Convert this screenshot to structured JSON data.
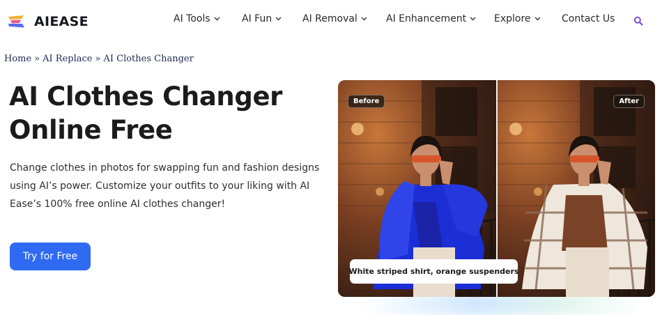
{
  "brand": {
    "name": "AIEASE",
    "colors": [
      "#f2b233",
      "#ec5a8c",
      "#5b6cf0"
    ]
  },
  "nav": {
    "items": [
      {
        "label": "AI Tools",
        "dropdown": true
      },
      {
        "label": "AI Fun",
        "dropdown": true
      },
      {
        "label": "AI Removal",
        "dropdown": true
      },
      {
        "label": "AI Enhancement",
        "dropdown": true
      },
      {
        "label": "Explore",
        "dropdown": true
      },
      {
        "label": "Contact Us",
        "dropdown": false
      }
    ],
    "search_icon": "search-icon"
  },
  "breadcrumb": {
    "items": [
      "Home",
      "AI Replace",
      "AI Clothes Changer"
    ],
    "separator": "»"
  },
  "hero": {
    "title_line1": "AI Clothes Changer",
    "title_line2": "Online Free",
    "description": "Change clothes in photos for swapping fun and fashion designs using AI’s power. Customize your outfits to your liking with AI Ease’s 100% free online AI clothes changer!",
    "cta_label": "Try for Free"
  },
  "compare": {
    "before_label": "Before",
    "after_label": "After",
    "prompt": "White striped shirt, orange suspenders"
  },
  "colors": {
    "accent": "#2f6bf2",
    "search": "#7b4fe0",
    "before_jacket": "#1c2fd6",
    "after_top": "#7a4328"
  }
}
